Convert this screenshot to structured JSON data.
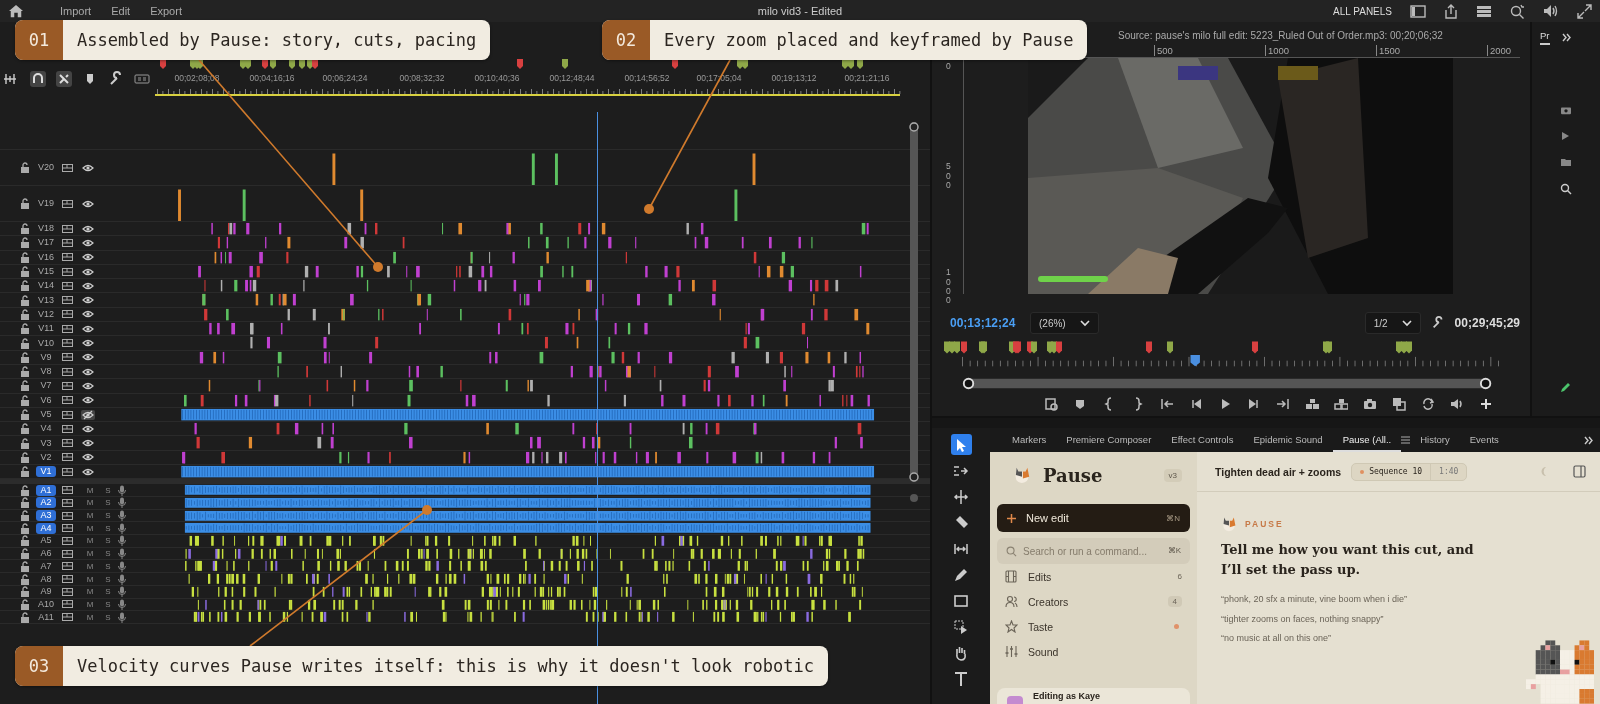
{
  "top_bar": {
    "menu": [
      "Import",
      "Edit",
      "Export"
    ],
    "title": "milo vid3 - Edited",
    "panels_label": "ALL PANELS"
  },
  "timeline": {
    "ruler": [
      "00;02;08;08",
      "00;04;16;16",
      "00;06;24;24",
      "00;08;32;32",
      "00;10;40;36",
      "00;12;48;44",
      "00;14;56;52",
      "00;17;05;04",
      "00;19;13;12",
      "00;21;21;16"
    ],
    "video_tracks": [
      {
        "label": "V20",
        "targeted": false,
        "visible": true,
        "kind": "sparse"
      },
      {
        "label": "V19",
        "targeted": false,
        "visible": true,
        "kind": "sparse"
      },
      {
        "label": "V18",
        "targeted": false,
        "visible": true,
        "kind": "sparse"
      },
      {
        "label": "V17",
        "targeted": false,
        "visible": true,
        "kind": "sparse"
      },
      {
        "label": "V16",
        "targeted": false,
        "visible": true,
        "kind": "sparse"
      },
      {
        "label": "V15",
        "targeted": false,
        "visible": true,
        "kind": "sparse"
      },
      {
        "label": "V14",
        "targeted": false,
        "visible": true,
        "kind": "sparse"
      },
      {
        "label": "V13",
        "targeted": false,
        "visible": true,
        "kind": "sparse"
      },
      {
        "label": "V12",
        "targeted": false,
        "visible": true,
        "kind": "sparse"
      },
      {
        "label": "V11",
        "targeted": false,
        "visible": true,
        "kind": "sparse"
      },
      {
        "label": "V10",
        "targeted": false,
        "visible": true,
        "kind": "sparse"
      },
      {
        "label": "V9",
        "targeted": false,
        "visible": true,
        "kind": "sparse"
      },
      {
        "label": "V8",
        "targeted": false,
        "visible": true,
        "kind": "sparse"
      },
      {
        "label": "V7",
        "targeted": false,
        "visible": true,
        "kind": "sparse"
      },
      {
        "label": "V6",
        "targeted": false,
        "visible": true,
        "kind": "sparse"
      },
      {
        "label": "V5",
        "targeted": false,
        "visible": false,
        "kind": "dense"
      },
      {
        "label": "V4",
        "targeted": false,
        "visible": true,
        "kind": "sparse"
      },
      {
        "label": "V3",
        "targeted": false,
        "visible": true,
        "kind": "sparse"
      },
      {
        "label": "V2",
        "targeted": false,
        "visible": true,
        "kind": "sparse"
      },
      {
        "label": "V1",
        "targeted": true,
        "visible": true,
        "kind": "dense"
      }
    ],
    "audio_tracks": [
      {
        "label": "A1",
        "targeted": true,
        "kind": "dense",
        "mute": "M",
        "solo": "S"
      },
      {
        "label": "A2",
        "targeted": true,
        "kind": "dense",
        "mute": "M",
        "solo": "S"
      },
      {
        "label": "A3",
        "targeted": true,
        "kind": "dense",
        "mute": "M",
        "solo": "S"
      },
      {
        "label": "A4",
        "targeted": true,
        "kind": "dense",
        "mute": "M",
        "solo": "S"
      },
      {
        "label": "A5",
        "targeted": false,
        "kind": "sparse",
        "mute": "M",
        "solo": "S"
      },
      {
        "label": "A6",
        "targeted": false,
        "kind": "sparse",
        "mute": "M",
        "solo": "S"
      },
      {
        "label": "A7",
        "targeted": false,
        "kind": "sparse",
        "mute": "M",
        "solo": "S"
      },
      {
        "label": "A8",
        "targeted": false,
        "kind": "sparse",
        "mute": "M",
        "solo": "S"
      },
      {
        "label": "A9",
        "targeted": false,
        "kind": "sparse",
        "mute": "M",
        "solo": "S"
      },
      {
        "label": "A10",
        "targeted": false,
        "kind": "sparse",
        "mute": "M",
        "solo": "S"
      },
      {
        "label": "A11",
        "targeted": false,
        "kind": "sparse",
        "mute": "M",
        "solo": "S"
      }
    ]
  },
  "program_monitor": {
    "source": "Source: pause's milo full edit: 5223_Ruled Out of Order.mp3: 00;20;06;32",
    "ruler": [
      "500",
      "1000",
      "1500",
      "2000"
    ],
    "v_ruler": [
      "0",
      "500",
      "1000"
    ],
    "timecode": "00;13;12;24",
    "zoom": "(26%)",
    "resolution": "1/2",
    "duration": "00;29;45;29"
  },
  "side_strip": {
    "tab": "Pr"
  },
  "panel_tabs": [
    {
      "label": "Markers",
      "selected": false
    },
    {
      "label": "Premiere Composer",
      "selected": false
    },
    {
      "label": "Effect Controls",
      "selected": false
    },
    {
      "label": "Epidemic Sound",
      "selected": false
    },
    {
      "label": "Pause (All..",
      "selected": true
    },
    {
      "label": "History",
      "selected": false
    },
    {
      "label": "Events",
      "selected": false
    }
  ],
  "tools": [
    {
      "kind": "select",
      "selected": true
    },
    {
      "kind": "track",
      "selected": false
    },
    {
      "kind": "ripple",
      "selected": false
    },
    {
      "kind": "razor",
      "selected": false
    },
    {
      "kind": "slip",
      "selected": false
    },
    {
      "kind": "pen",
      "selected": false
    },
    {
      "kind": "rect",
      "selected": false
    },
    {
      "kind": "remix",
      "selected": false
    },
    {
      "kind": "hand",
      "selected": false
    },
    {
      "kind": "type",
      "selected": false
    }
  ],
  "pause": {
    "brand": "Pause",
    "version": "v3",
    "new_edit": {
      "label": "New edit",
      "shortcut": "⌘N"
    },
    "search": {
      "placeholder": "Search or run a command...",
      "shortcut": "⌘K"
    },
    "nav": [
      {
        "kind": "film",
        "label": "Edits",
        "count": "6",
        "dot": false
      },
      {
        "kind": "people",
        "label": "Creators",
        "count": "4",
        "dot": false
      },
      {
        "kind": "star",
        "label": "Taste",
        "dot": true
      },
      {
        "kind": "sliders",
        "label": "Sound",
        "dot": false
      }
    ],
    "account": "Editing as Kaye",
    "header": {
      "title": "Tighten dead air + zooms",
      "sequence": "Sequence 10",
      "duration": "1:40"
    },
    "assistant_label": "PAUSE",
    "prompt": "Tell me how you want this cut, and I’ll set the pass up.",
    "examples": [
      "“phonk, 20 sfx a minute, vine boom when i die”",
      "“tighter zooms on faces, nothing snappy”",
      "“no music at all on this one”"
    ]
  },
  "callouts": [
    {
      "number": "01",
      "text": "Assembled by Pause: story, cuts, pacing"
    },
    {
      "number": "02",
      "text": "Every zoom placed and keyframed by Pause"
    },
    {
      "number": "03",
      "text": "Velocity curves Pause writes itself: this is why it doesn't look robotic"
    }
  ]
}
